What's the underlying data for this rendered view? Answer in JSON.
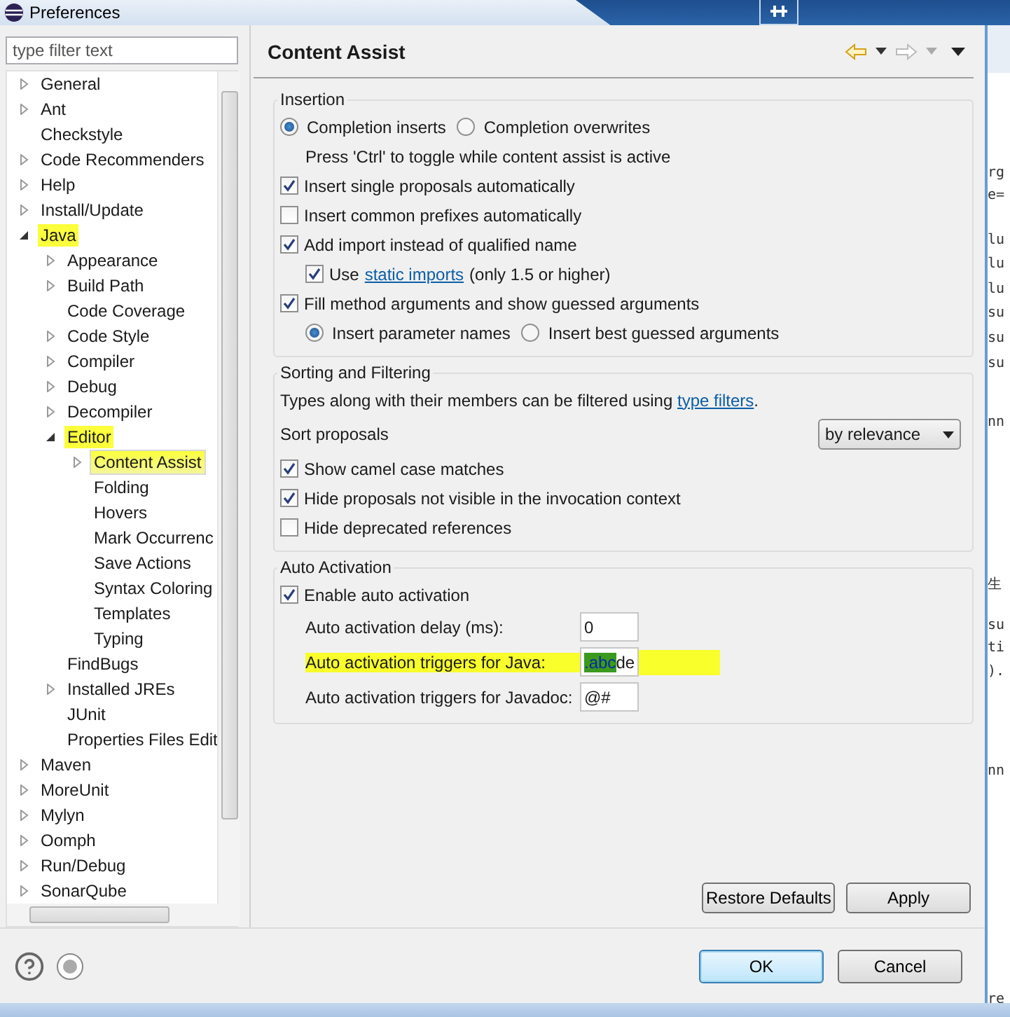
{
  "window": {
    "title": "Preferences"
  },
  "sidebar": {
    "filter_placeholder": "type filter text",
    "items": [
      {
        "label": "General",
        "expandable": true,
        "expanded": false,
        "selected": false,
        "highlighted": false
      },
      {
        "label": "Ant",
        "expandable": true,
        "expanded": false,
        "selected": false,
        "highlighted": false
      },
      {
        "label": "Checkstyle",
        "expandable": false,
        "selected": false,
        "highlighted": false
      },
      {
        "label": "Code Recommenders",
        "expandable": true,
        "expanded": false,
        "selected": false,
        "highlighted": false
      },
      {
        "label": "Help",
        "expandable": true,
        "expanded": false,
        "selected": false,
        "highlighted": false
      },
      {
        "label": "Install/Update",
        "expandable": true,
        "expanded": false,
        "selected": false,
        "highlighted": false
      },
      {
        "label": "Java",
        "expandable": true,
        "expanded": true,
        "selected": false,
        "highlighted": true,
        "children": [
          {
            "label": "Appearance",
            "expandable": true,
            "expanded": false,
            "selected": false,
            "highlighted": false
          },
          {
            "label": "Build Path",
            "expandable": true,
            "expanded": false,
            "selected": false,
            "highlighted": false
          },
          {
            "label": "Code Coverage",
            "expandable": false,
            "selected": false,
            "highlighted": false
          },
          {
            "label": "Code Style",
            "expandable": true,
            "expanded": false,
            "selected": false,
            "highlighted": false
          },
          {
            "label": "Compiler",
            "expandable": true,
            "expanded": false,
            "selected": false,
            "highlighted": false
          },
          {
            "label": "Debug",
            "expandable": true,
            "expanded": false,
            "selected": false,
            "highlighted": false
          },
          {
            "label": "Decompiler",
            "expandable": true,
            "expanded": false,
            "selected": false,
            "highlighted": false
          },
          {
            "label": "Editor",
            "expandable": true,
            "expanded": true,
            "selected": false,
            "highlighted": true,
            "children": [
              {
                "label": "Content Assist",
                "expandable": true,
                "expanded": false,
                "selected": true,
                "highlighted": true
              },
              {
                "label": "Folding",
                "expandable": false,
                "selected": false,
                "highlighted": false
              },
              {
                "label": "Hovers",
                "expandable": false,
                "selected": false,
                "highlighted": false
              },
              {
                "label": "Mark Occurrenc",
                "expandable": false,
                "selected": false,
                "highlighted": false
              },
              {
                "label": "Save Actions",
                "expandable": false,
                "selected": false,
                "highlighted": false
              },
              {
                "label": "Syntax Coloring",
                "expandable": false,
                "selected": false,
                "highlighted": false
              },
              {
                "label": "Templates",
                "expandable": false,
                "selected": false,
                "highlighted": false
              },
              {
                "label": "Typing",
                "expandable": false,
                "selected": false,
                "highlighted": false
              }
            ]
          },
          {
            "label": "FindBugs",
            "expandable": false,
            "selected": false,
            "highlighted": false
          },
          {
            "label": "Installed JREs",
            "expandable": true,
            "expanded": false,
            "selected": false,
            "highlighted": false
          },
          {
            "label": "JUnit",
            "expandable": false,
            "selected": false,
            "highlighted": false
          },
          {
            "label": "Properties Files Edit",
            "expandable": false,
            "selected": false,
            "highlighted": false
          }
        ]
      },
      {
        "label": "Maven",
        "expandable": true,
        "expanded": false,
        "selected": false,
        "highlighted": false
      },
      {
        "label": "MoreUnit",
        "expandable": true,
        "expanded": false,
        "selected": false,
        "highlighted": false
      },
      {
        "label": "Mylyn",
        "expandable": true,
        "expanded": false,
        "selected": false,
        "highlighted": false
      },
      {
        "label": "Oomph",
        "expandable": true,
        "expanded": false,
        "selected": false,
        "highlighted": false
      },
      {
        "label": "Run/Debug",
        "expandable": true,
        "expanded": false,
        "selected": false,
        "highlighted": false
      },
      {
        "label": "SonarQube",
        "expandable": true,
        "expanded": false,
        "selected": false,
        "highlighted": false
      }
    ]
  },
  "page": {
    "title": "Content Assist",
    "insertion": {
      "title": "Insertion",
      "items": [
        {
          "kind": "radio_group",
          "options": [
            {
              "label": "Completion inserts",
              "selected": true
            },
            {
              "label": "Completion overwrites",
              "selected": false
            }
          ]
        },
        {
          "kind": "note",
          "text": "Press 'Ctrl' to toggle while content assist is active"
        },
        {
          "kind": "checkbox",
          "label": "Insert single proposals automatically",
          "checked": true
        },
        {
          "kind": "checkbox",
          "label": "Insert common prefixes automatically",
          "checked": false
        },
        {
          "kind": "checkbox",
          "label": "Add import instead of qualified name",
          "checked": true,
          "children": [
            {
              "kind": "link_checkbox",
              "label_before": "Use",
              "link": "static imports",
              "label_after": "(only 1.5 or higher)",
              "checked": true
            }
          ]
        },
        {
          "kind": "checkbox",
          "label": "Fill method arguments and show guessed arguments",
          "checked": true,
          "children": [
            {
              "kind": "radio_group",
              "options": [
                {
                  "label": "Insert parameter names",
                  "selected": true
                },
                {
                  "label": "Insert best guessed arguments",
                  "selected": false
                }
              ]
            }
          ]
        }
      ]
    },
    "sorting": {
      "title": "Sorting and Filtering",
      "description": "Types along with their members can be filtered using ",
      "link": "type filters",
      "description_end": ".",
      "sort_label": "Sort proposals",
      "sort_value": "by relevance",
      "checkboxes": [
        {
          "label": "Show camel case matches",
          "checked": true
        },
        {
          "label": "Hide proposals not visible in the invocation context",
          "checked": true
        },
        {
          "label": "Hide deprecated references",
          "checked": false
        }
      ]
    },
    "auto_activation": {
      "title": "Auto Activation",
      "enable": {
        "label": "Enable auto activation",
        "checked": true
      },
      "fields": [
        {
          "label": "Auto activation delay (ms):",
          "value": "0",
          "highlighted": false
        },
        {
          "label": "Auto activation triggers for Java:",
          "value_selected": ".abc",
          "value": "de",
          "highlighted": true
        },
        {
          "label": "Auto activation triggers for Javadoc:",
          "value": "@#",
          "highlighted": false
        }
      ]
    },
    "buttons": [
      "Restore Defaults",
      "Apply"
    ]
  },
  "footer": {
    "buttons": [
      {
        "label": "OK",
        "default": true
      },
      {
        "label": "Cancel",
        "default": false
      }
    ]
  },
  "background_editor": {
    "lines": [
      "rg",
      "e=",
      "lu",
      "lu",
      "lu",
      "su",
      "su",
      "su",
      "nn",
      "生",
      "su",
      "ti",
      ").",
      "nn",
      "re"
    ]
  }
}
